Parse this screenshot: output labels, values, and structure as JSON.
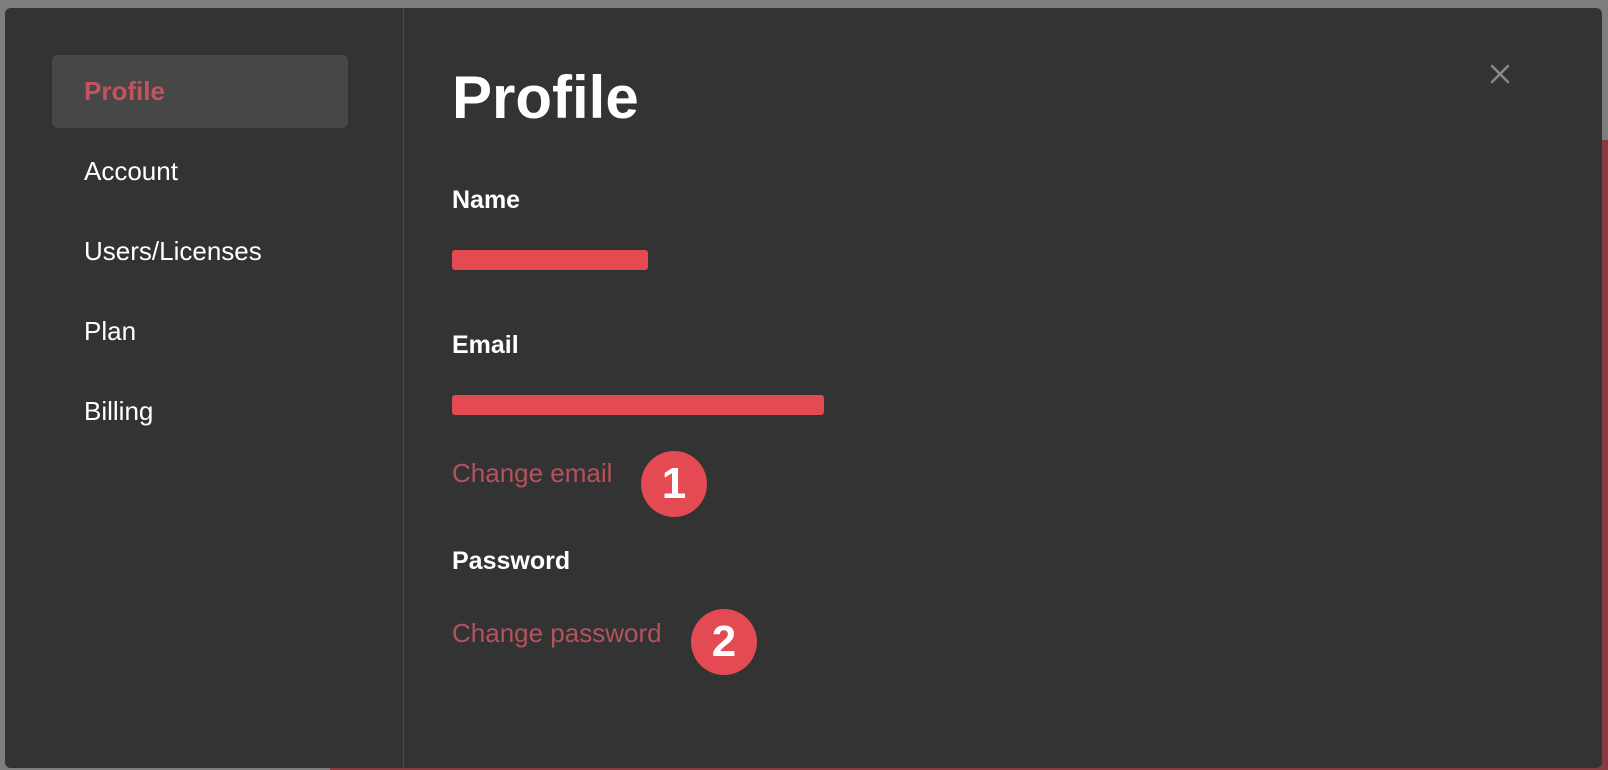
{
  "sidebar": {
    "items": [
      {
        "label": "Profile",
        "active": true
      },
      {
        "label": "Account",
        "active": false
      },
      {
        "label": "Users/Licenses",
        "active": false
      },
      {
        "label": "Plan",
        "active": false
      },
      {
        "label": "Billing",
        "active": false
      }
    ]
  },
  "main": {
    "title": "Profile",
    "close_icon": "close-icon",
    "sections": {
      "name": {
        "label": "Name"
      },
      "email": {
        "label": "Email",
        "action_label": "Change email"
      },
      "password": {
        "label": "Password",
        "action_label": "Change password"
      }
    }
  },
  "annotations": {
    "step1": "1",
    "step2": "2"
  },
  "colors": {
    "accent": "#c2545e",
    "link": "#b5525c",
    "redaction": "#e34a51",
    "modal_background": "#333333",
    "active_nav_background": "#474747"
  }
}
